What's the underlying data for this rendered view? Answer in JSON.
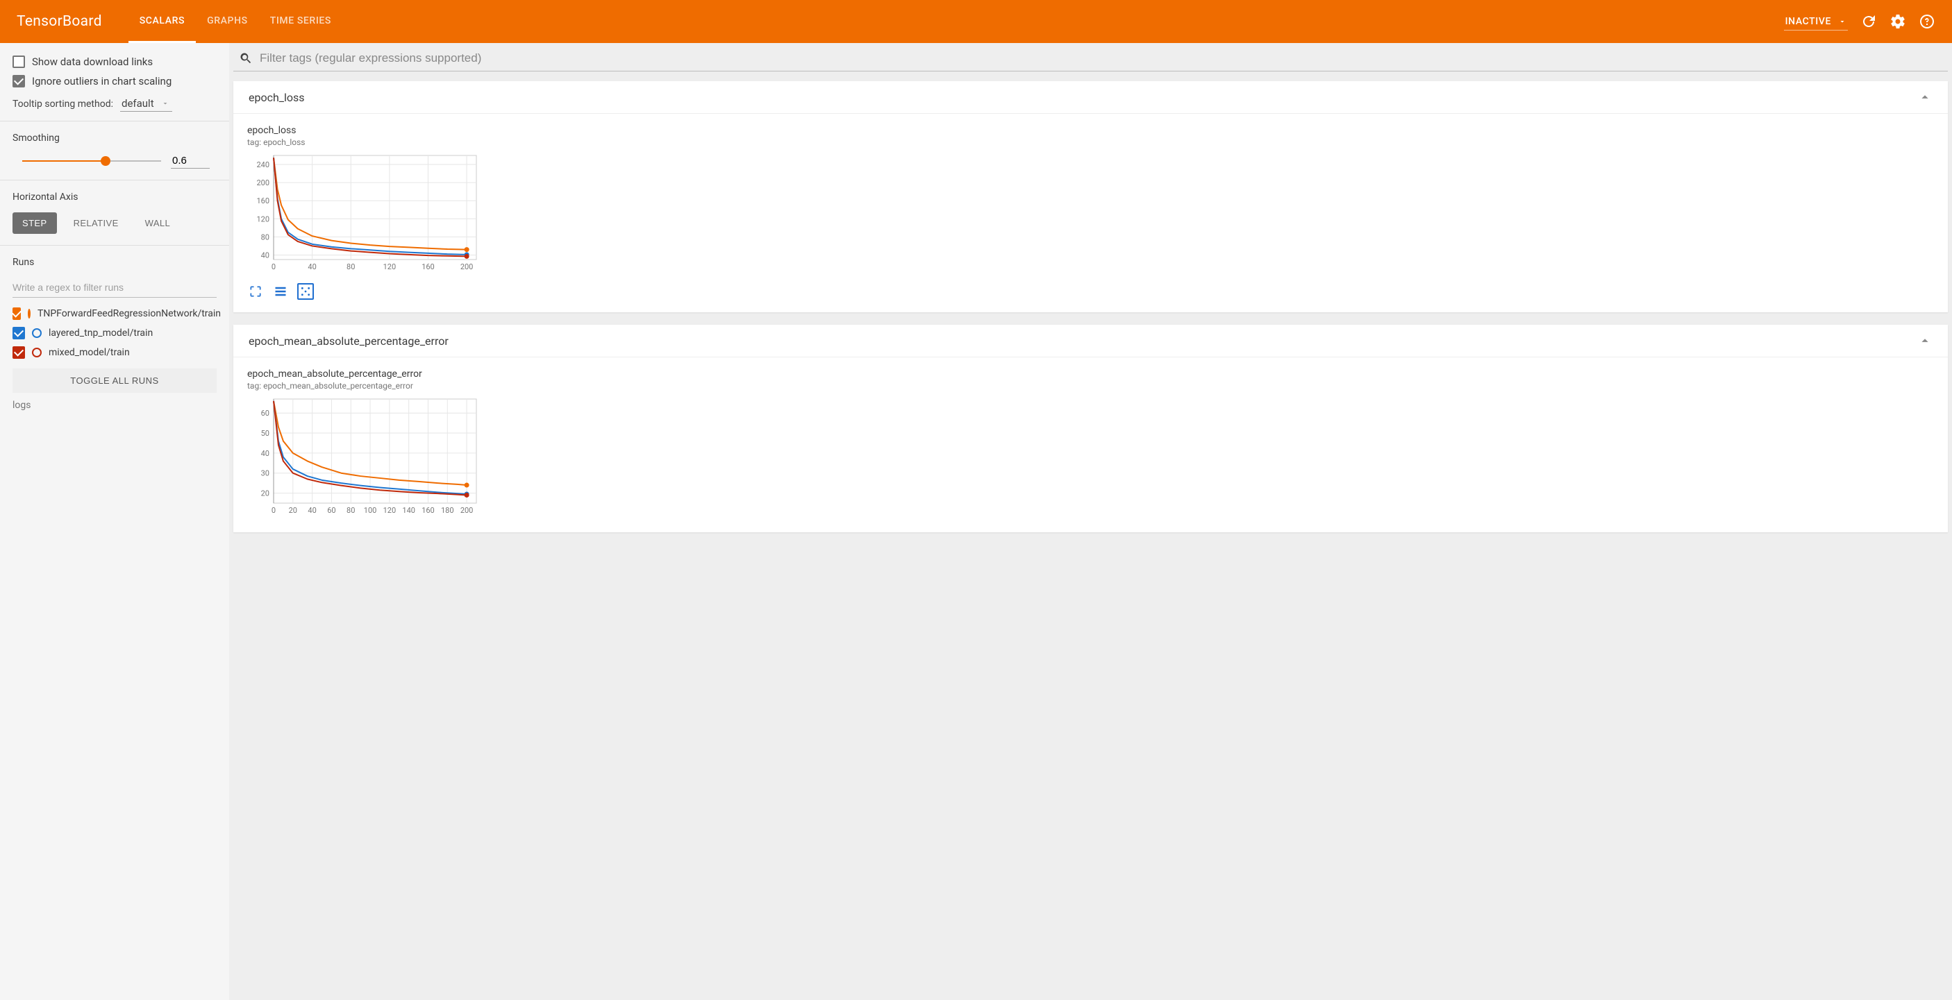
{
  "header": {
    "logo": "TensorBoard",
    "tabs": [
      "SCALARS",
      "GRAPHS",
      "TIME SERIES"
    ],
    "active_tab": 0,
    "mode_select": "INACTIVE"
  },
  "sidebar": {
    "show_download_links": {
      "label": "Show data download links",
      "checked": false
    },
    "ignore_outliers": {
      "label": "Ignore outliers in chart scaling",
      "checked": true
    },
    "tooltip_sort": {
      "label": "Tooltip sorting method:",
      "value": "default"
    },
    "smoothing": {
      "label": "Smoothing",
      "value": "0.6",
      "percent": 60
    },
    "horizontal_axis": {
      "label": "Horizontal Axis",
      "options": [
        "STEP",
        "RELATIVE",
        "WALL"
      ],
      "active": 0
    },
    "runs": {
      "label": "Runs",
      "filter_placeholder": "Write a regex to filter runs",
      "items": [
        {
          "label": "TNPForwardFeedRegressionNetwork/train",
          "color": "#ef6c00",
          "checked": true
        },
        {
          "label": "layered_tnp_model/train",
          "color": "#1f77d0",
          "checked": true
        },
        {
          "label": "mixed_model/train",
          "color": "#c0290b",
          "checked": true
        }
      ],
      "toggle_all": "TOGGLE ALL RUNS",
      "root": "logs"
    }
  },
  "main": {
    "filter_placeholder": "Filter tags (regular expressions supported)",
    "cards": [
      {
        "id": "epoch_loss",
        "title": "epoch_loss",
        "chart_title": "epoch_loss",
        "chart_tag": "tag: epoch_loss"
      },
      {
        "id": "epoch_mape",
        "title": "epoch_mean_absolute_percentage_error",
        "chart_title": "epoch_mean_absolute_percentage_error",
        "chart_tag": "tag: epoch_mean_absolute_percentage_error"
      }
    ]
  },
  "chart_data": [
    {
      "type": "line",
      "title": "epoch_loss",
      "xlabel": "",
      "ylabel": "",
      "xlim": [
        0,
        210
      ],
      "ylim": [
        30,
        260
      ],
      "xticks": [
        0,
        40,
        80,
        120,
        160,
        200
      ],
      "yticks": [
        40,
        80,
        120,
        160,
        200,
        240
      ],
      "series": [
        {
          "name": "TNPForwardFeedRegressionNetwork/train",
          "color": "#ef6c00",
          "x": [
            0,
            4,
            8,
            15,
            25,
            40,
            60,
            80,
            100,
            120,
            140,
            160,
            180,
            200
          ],
          "y": [
            255,
            185,
            150,
            118,
            98,
            82,
            72,
            66,
            62,
            59,
            57,
            55,
            53,
            52
          ]
        },
        {
          "name": "layered_tnp_model/train",
          "color": "#1f77d0",
          "x": [
            0,
            4,
            8,
            15,
            25,
            40,
            60,
            80,
            100,
            120,
            140,
            160,
            180,
            200
          ],
          "y": [
            255,
            165,
            120,
            90,
            75,
            64,
            58,
            54,
            51,
            48,
            46,
            44,
            42,
            41
          ]
        },
        {
          "name": "mixed_model/train",
          "color": "#c0290b",
          "x": [
            0,
            4,
            8,
            15,
            25,
            40,
            60,
            80,
            100,
            120,
            140,
            160,
            180,
            200
          ],
          "y": [
            255,
            160,
            115,
            85,
            70,
            60,
            54,
            49,
            46,
            43,
            41,
            39,
            38,
            37
          ]
        }
      ]
    },
    {
      "type": "line",
      "title": "epoch_mean_absolute_percentage_error",
      "xlabel": "",
      "ylabel": "",
      "xlim": [
        0,
        210
      ],
      "ylim": [
        15,
        67
      ],
      "xticks": [
        0,
        20,
        40,
        60,
        80,
        100,
        120,
        140,
        160,
        180,
        200
      ],
      "yticks": [
        20,
        30,
        40,
        50,
        60
      ],
      "series": [
        {
          "name": "TNPForwardFeedRegressionNetwork/train",
          "color": "#ef6c00",
          "x": [
            0,
            5,
            10,
            20,
            35,
            50,
            70,
            90,
            110,
            130,
            150,
            170,
            190,
            200
          ],
          "y": [
            66,
            53,
            46,
            40,
            36,
            33,
            30,
            28.5,
            27.5,
            26.5,
            25.8,
            25.0,
            24.4,
            24.0
          ]
        },
        {
          "name": "layered_tnp_model/train",
          "color": "#1f77d0",
          "x": [
            0,
            5,
            10,
            20,
            35,
            50,
            70,
            90,
            110,
            130,
            150,
            170,
            190,
            200
          ],
          "y": [
            66,
            46,
            38,
            32,
            28.5,
            26.5,
            25.0,
            23.8,
            22.8,
            22.0,
            21.2,
            20.4,
            19.8,
            19.5
          ]
        },
        {
          "name": "mixed_model/train",
          "color": "#c0290b",
          "x": [
            0,
            5,
            10,
            20,
            35,
            50,
            70,
            90,
            110,
            130,
            150,
            170,
            190,
            200
          ],
          "y": [
            66,
            44,
            36,
            30,
            27,
            25.3,
            23.8,
            22.5,
            21.5,
            20.8,
            20.2,
            19.8,
            19.3,
            19.0
          ]
        }
      ]
    }
  ]
}
